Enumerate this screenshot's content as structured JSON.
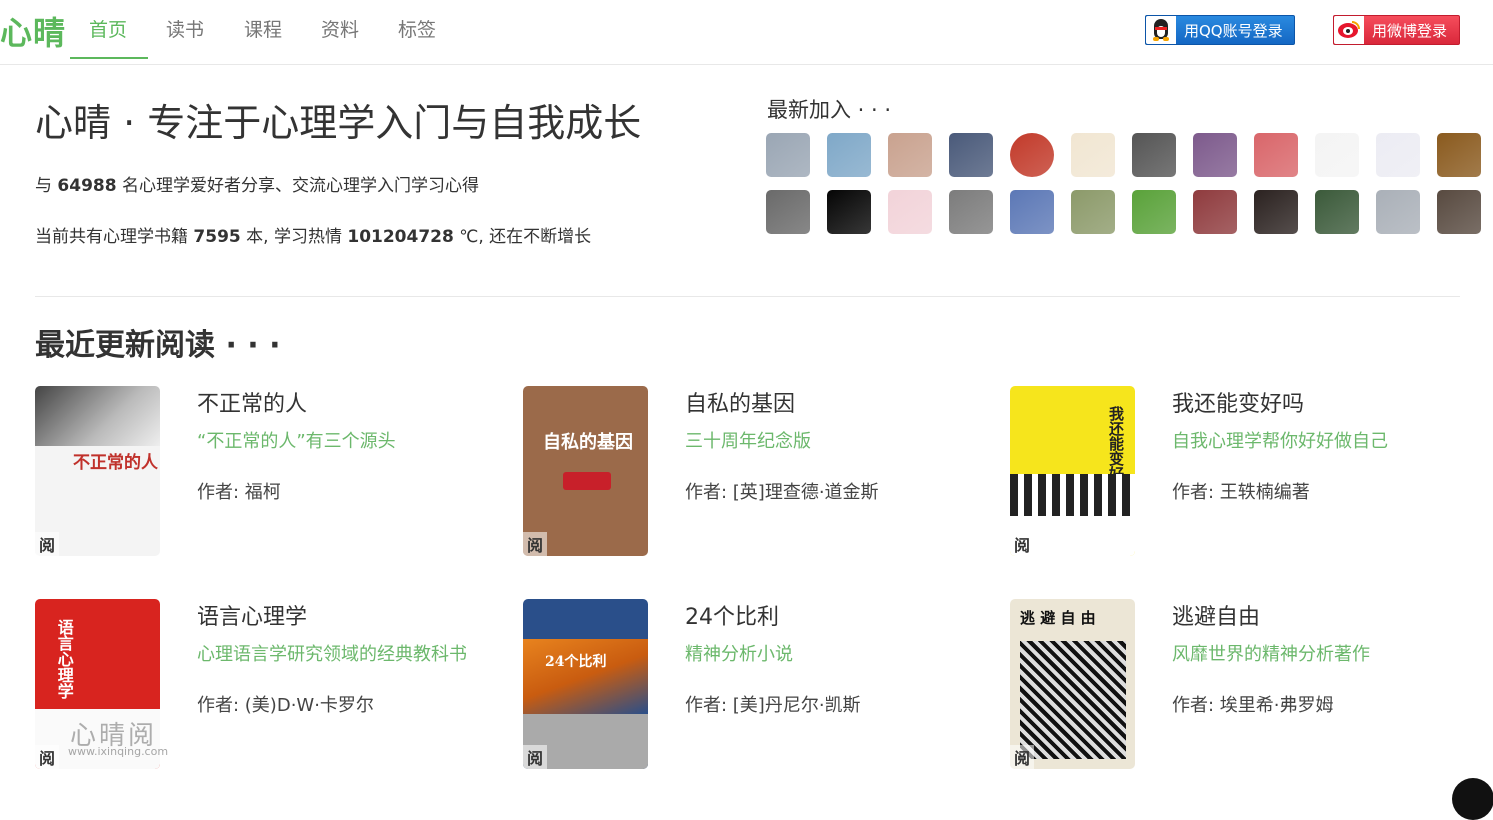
{
  "nav": {
    "logo": "心晴",
    "links": [
      "首页",
      "读书",
      "课程",
      "资料",
      "标签"
    ],
    "qq_login": "用QQ账号登录",
    "weibo_login": "用微博登录"
  },
  "hero": {
    "title": "心晴 · 专注于心理学入门与自我成长",
    "line1_pre": "与 ",
    "line1_count": "64988",
    "line1_post": " 名心理学爱好者分享、交流心理学入门学习心得",
    "line2_pre": "当前共有心理学书籍 ",
    "line2_books": "7595",
    "line2_mid": " 本, 学习热情 ",
    "line2_heat": "101204728",
    "line2_post": " ℃, 还在不断增长"
  },
  "latest": {
    "title": "最新加入 · · ·",
    "avatar_colors": [
      "#9aa6b4",
      "#7fa8c8",
      "#c9a28f",
      "#4a5a7a",
      "#c23a2a",
      "#f1e6d2",
      "#555555",
      "#7d5a8c",
      "#d9666a",
      "#f4f4f4",
      "#ececf3",
      "#8a5a1e",
      "#6a6a6a",
      "#050505",
      "#f2d3d9",
      "#7c7c7c",
      "#5c78b6",
      "#8c9a6a",
      "#5aa23a",
      "#8f3b3e",
      "#2b2220",
      "#3b5a3a",
      "#aab0b8",
      "#584a40"
    ]
  },
  "recent": {
    "title": "最近更新阅读 · · ·",
    "read_tag": "阅",
    "books": [
      {
        "title": "不正常的人",
        "subtitle": "“不正常的人”有三个源头",
        "author": "作者: 福柯",
        "cover_text": "不正常的人",
        "cover_bg": "#f4f4f4",
        "cover_fg": "#c0312b"
      },
      {
        "title": "自私的基因",
        "subtitle": "三十周年纪念版",
        "author": "作者: [英]理查德·道金斯",
        "cover_text": "自私的基因",
        "cover_bg": "#9b6a4a",
        "cover_fg": "#ffffff"
      },
      {
        "title": "我还能变好吗",
        "subtitle": "自我心理学帮你好好做自己",
        "author": "作者: 王轶楠编著",
        "cover_text": "我还能变好吗",
        "cover_bg": "#f6e51c",
        "cover_fg": "#222222"
      },
      {
        "title": "语言心理学",
        "subtitle": "心理语言学研究领域的经典教科书",
        "author": "作者: (美)D·W·卡罗尔",
        "cover_text": "语言心理学",
        "cover_bg": "#d8241f",
        "cover_fg": "#ffffff"
      },
      {
        "title": "24个比利",
        "subtitle": "精神分析小说",
        "author": "作者: [美]丹尼尔·凯斯",
        "cover_text": "24个比利",
        "cover_bg": "#2a4f8a",
        "cover_fg": "#ffffff"
      },
      {
        "title": "逃避自由",
        "subtitle": "风靡世界的精神分析著作",
        "author": "作者: 埃里希·弗罗姆",
        "cover_text": "逃 避 自 由",
        "cover_bg": "#ece6d6",
        "cover_fg": "#111111"
      }
    ]
  },
  "watermark": {
    "name": "心晴阅",
    "url": "www.ixinqing.com"
  }
}
